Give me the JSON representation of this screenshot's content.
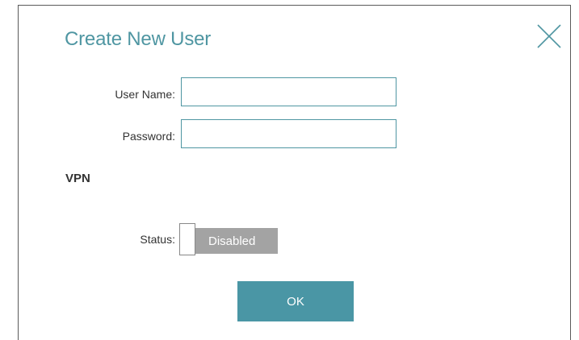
{
  "dialog": {
    "title": "Create New User",
    "close_icon": "close-icon"
  },
  "form": {
    "username_label": "User Name:",
    "username_value": "",
    "password_label": "Password:",
    "password_value": ""
  },
  "vpn": {
    "heading": "VPN",
    "status_label": "Status:",
    "toggle_text": "Disabled",
    "enabled": false
  },
  "actions": {
    "ok_label": "OK"
  },
  "colors": {
    "accent": "#4f96a2",
    "button": "#4a96a5",
    "toggle_off": "#a3a3a3",
    "text": "#333333"
  }
}
